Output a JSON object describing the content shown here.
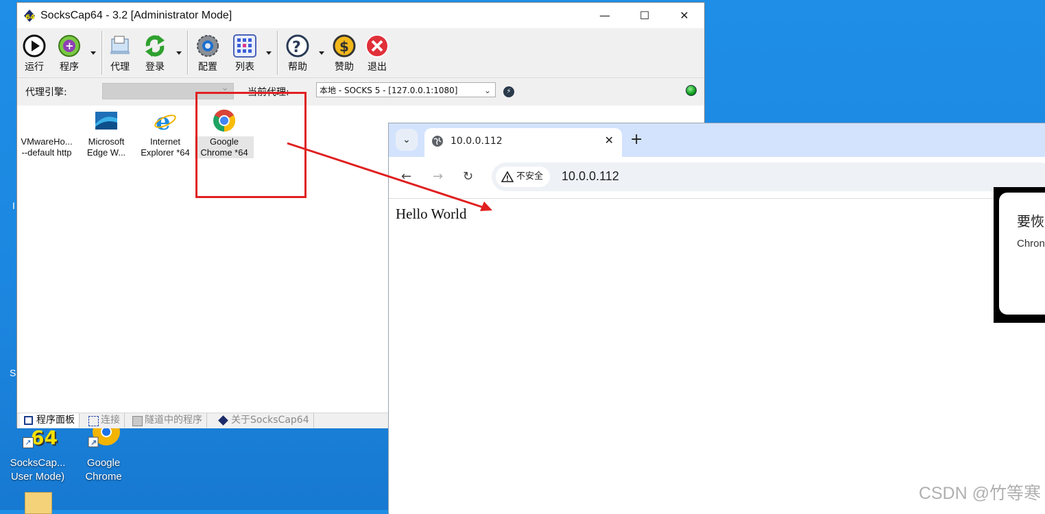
{
  "desktop": {
    "icons": [
      {
        "label_1": "SocksCap...",
        "label_2": "User Mode)"
      },
      {
        "label_1": "Google",
        "label_2": "Chrome"
      }
    ],
    "edge_chars": [
      "I",
      "S"
    ]
  },
  "sockscap": {
    "title": "SocksCap64 - 3.2 [Administrator Mode]",
    "window_buttons": {
      "minimize": "—",
      "maximize": "☐",
      "close": "✕"
    },
    "toolbar": {
      "run": "运行",
      "programs": "程序",
      "proxy": "代理",
      "login": "登录",
      "config": "配置",
      "list": "列表",
      "help": "帮助",
      "donate": "赞助",
      "exit": "退出"
    },
    "proxybar": {
      "engine_label": "代理引擎:",
      "current_label": "当前代理:",
      "current_value": "本地 - SOCKS 5 - [127.0.0.1:1080]"
    },
    "programs": [
      {
        "line1": "VMwareHo...",
        "line2": "--default http"
      },
      {
        "line1": "Microsoft",
        "line2": "Edge W..."
      },
      {
        "line1": "Internet",
        "line2": "Explorer *64"
      },
      {
        "line1": "Google",
        "line2": "Chrome *64"
      }
    ],
    "tabs": [
      "程序面板",
      "连接",
      "隧道中的程序",
      "关于SocksCap64"
    ]
  },
  "chrome": {
    "tab_title": "10.0.0.112",
    "security_label": "不安全",
    "url": "10.0.0.112",
    "page_text": "Hello World"
  },
  "restore_dialog": {
    "heading": "要恢",
    "body": "Chron"
  },
  "watermark": "CSDN @竹等寒",
  "colors": {
    "annotation_red": "#e02020",
    "chrome_tabstrip": "#d3e3fd",
    "desktop_blue": "#1e8ee6"
  }
}
